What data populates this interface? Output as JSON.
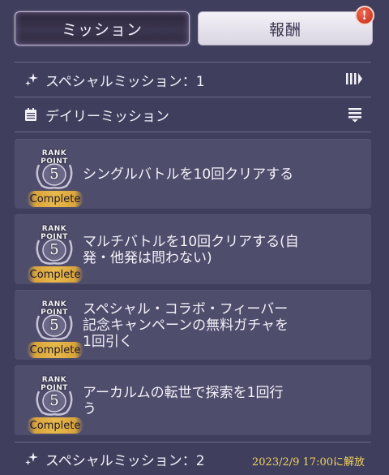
{
  "tabs": [
    {
      "label": "ミッション",
      "active": true
    },
    {
      "label": "報酬",
      "active": false,
      "alert": "!"
    }
  ],
  "sections": {
    "special1": {
      "label": "スペシャルミッション：1",
      "icon": "sparkle-icon",
      "right_icon": "bars-arrow-icon"
    },
    "daily": {
      "label": "デイリーミッション",
      "icon": "calendar-icon",
      "right_icon": "list-sort-icon"
    },
    "special2": {
      "label": "スペシャルミッション：2",
      "icon": "sparkle-icon",
      "unlock_text": "2023/2/9 17:00に解放"
    }
  },
  "missions": [
    {
      "rank_line1": "RANK",
      "rank_line2": "POINT",
      "points": "5",
      "status": "Complete",
      "text_line1": "シングルバトルを10回クリアする",
      "text_line2": "",
      "text_line3": ""
    },
    {
      "rank_line1": "RANK",
      "rank_line2": "POINT",
      "points": "5",
      "status": "Complete",
      "text_line1": "マルチバトルを10回クリアする(自",
      "text_line2": "発・他発は問わない)",
      "text_line3": ""
    },
    {
      "rank_line1": "RANK",
      "rank_line2": "POINT",
      "points": "5",
      "status": "Complete",
      "text_line1": "スペシャル・コラボ・フィーバー",
      "text_line2": "記念キャンペーンの無料ガチャを",
      "text_line3": "1回引く"
    },
    {
      "rank_line1": "RANK",
      "rank_line2": "POINT",
      "points": "5",
      "status": "Complete",
      "text_line1": "アーカルムの転世で探索を1回行",
      "text_line2": "う",
      "text_line3": ""
    }
  ],
  "colors": {
    "background": "#3f3e5d",
    "card": "#4f4d6c",
    "complete_gold": "#e8b94c",
    "unlock_yellow": "#f2d35e",
    "alert_red": "#c0281a"
  }
}
